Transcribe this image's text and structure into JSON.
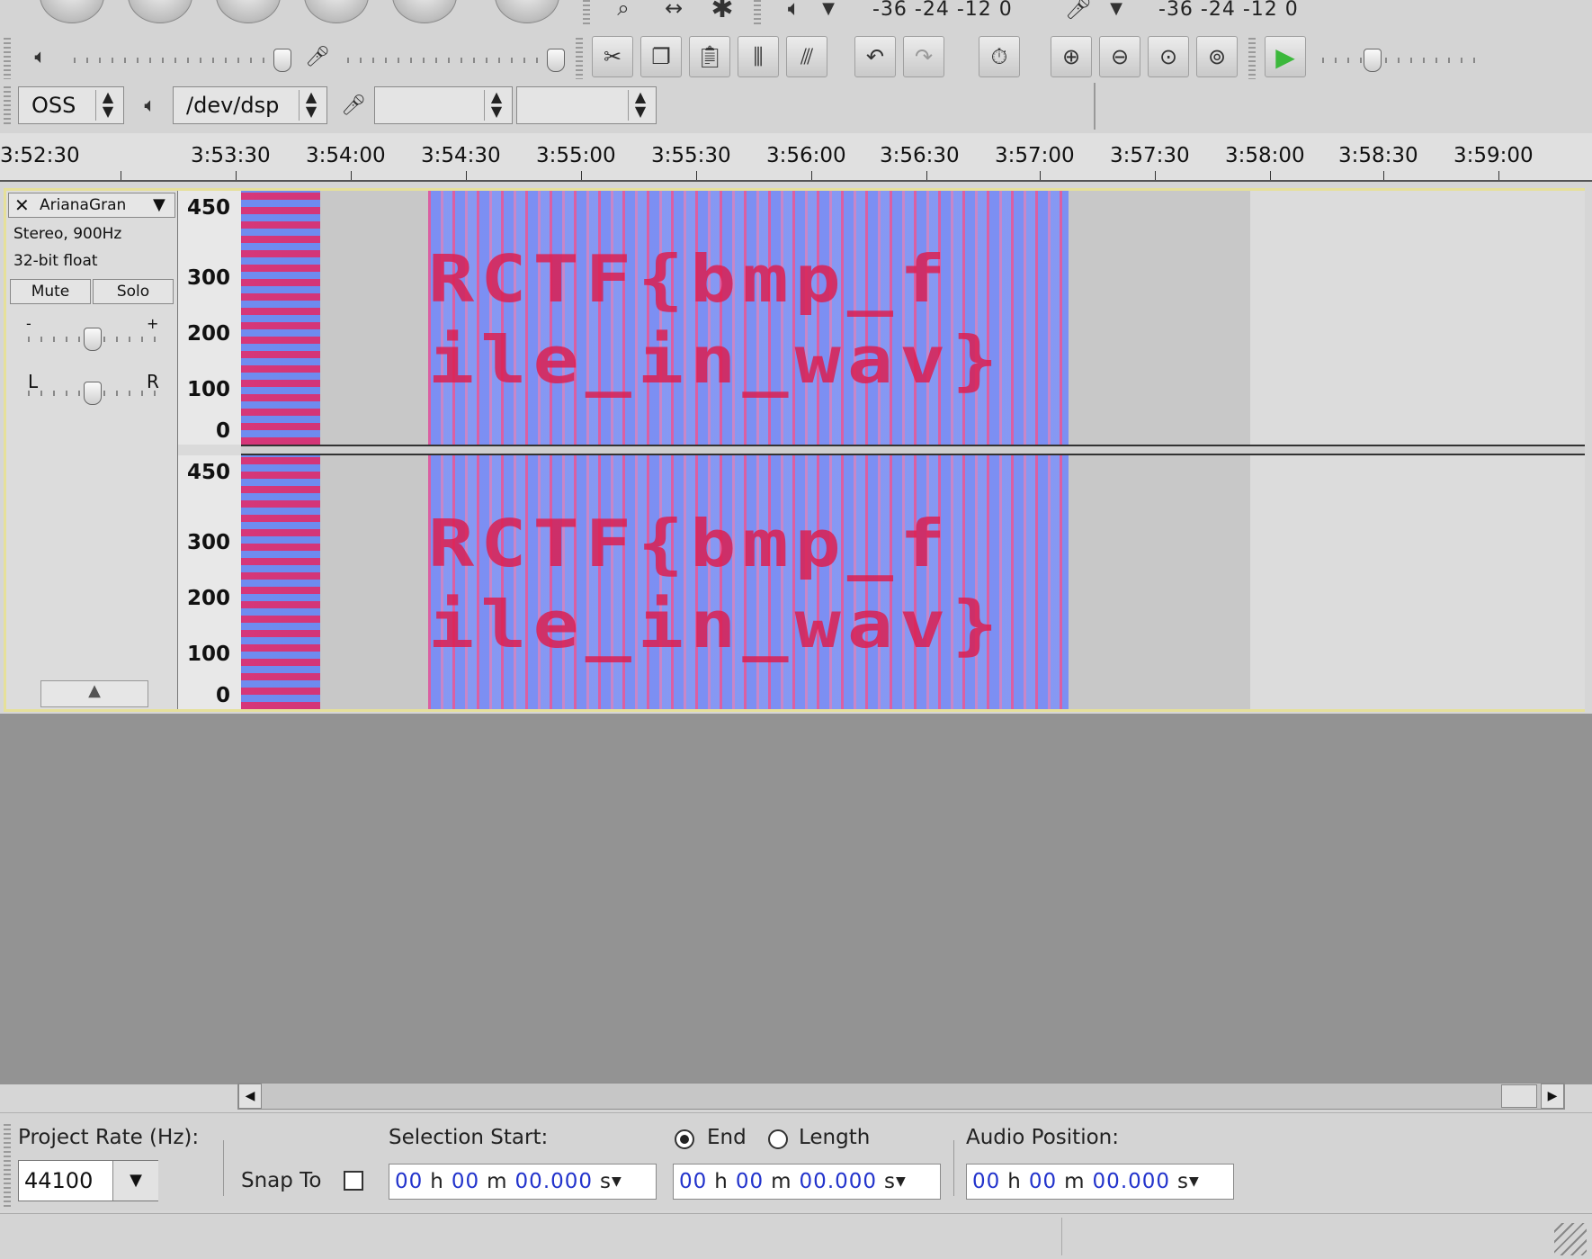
{
  "toolbar": {
    "meter_play_scale": "-36 -24 -12 0",
    "meter_rec_scale": "-36 -24 -12 0",
    "host": "OSS",
    "output_device": "/dev/dsp",
    "input_device": "",
    "input_channels": "",
    "icons": [
      "zoom-tool-icon",
      "timeshift-tool-icon",
      "multi-tool-icon",
      "speaker-icon",
      "mic-icon",
      "cut-icon",
      "copy-icon",
      "paste-icon",
      "trim-icon",
      "silence-icon",
      "undo-icon",
      "redo-icon",
      "timer-icon",
      "zoom-in-icon",
      "zoom-out-icon",
      "fit-selection-icon",
      "fit-project-icon",
      "play-at-speed-icon"
    ]
  },
  "ruler": {
    "ticks": [
      "3:52:30",
      "3:53:30",
      "3:54:00",
      "3:54:30",
      "3:55:00",
      "3:55:30",
      "3:56:00",
      "3:56:30",
      "3:57:00",
      "3:57:30",
      "3:58:00",
      "3:58:30",
      "3:59:00"
    ]
  },
  "track": {
    "name": "ArianaGran",
    "info_line1": "Stereo, 900Hz",
    "info_line2": "32-bit float",
    "mute_label": "Mute",
    "solo_label": "Solo",
    "gain_minus": "-",
    "gain_plus": "+",
    "pan_left": "L",
    "pan_right": "R",
    "freq_labels": [
      "450",
      "300",
      "200",
      "100",
      "0"
    ],
    "spectrogram_text_line1": "RCTF{bmp_f",
    "spectrogram_text_line2": "ile_in_wav}"
  },
  "selection_bar": {
    "project_rate_label": "Project Rate (Hz):",
    "project_rate_value": "44100",
    "snap_to_label": "Snap To",
    "selection_start_label": "Selection Start:",
    "end_label": "End",
    "length_label": "Length",
    "audio_position_label": "Audio Position:",
    "time_h": "00",
    "time_m": "00",
    "time_s": "00.000",
    "unit_h": "h",
    "unit_m": "m",
    "unit_s": "s"
  }
}
